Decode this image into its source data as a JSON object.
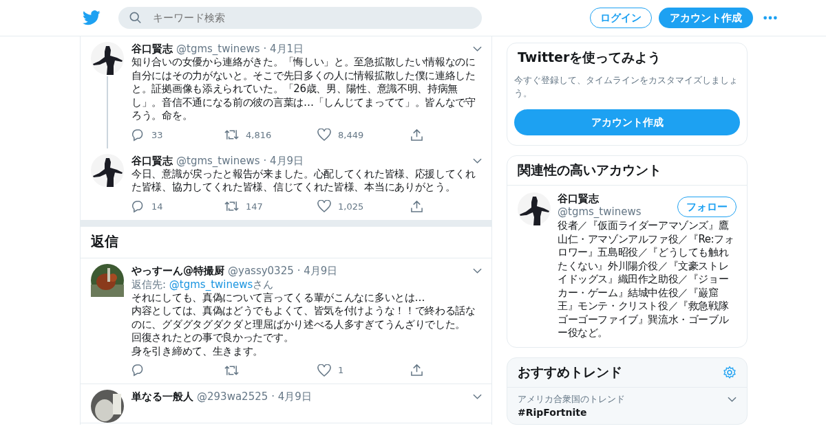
{
  "header": {
    "search_placeholder": "キーワード検索",
    "login": "ログイン",
    "signup": "アカウント作成"
  },
  "thread": [
    {
      "name": "谷口賢志",
      "handle": "@tgms_twinews",
      "date": "· 4月1日",
      "text": "知り合いの女優から連絡がきた。「悔しい」と。至急拡散したい情報なのに自分にはその力がないと。そこで先日多くの人に情報拡散した僕に連絡したと。証拠画像も添えられていた。「26歳、男、陽性、意識不明、持病無し」。音信不通になる前の彼の言葉は…「しんじてまってて」。皆んなで守ろう。命を。",
      "replies": "33",
      "retweets": "4,816",
      "likes": "8,449"
    },
    {
      "name": "谷口賢志",
      "handle": "@tgms_twinews",
      "date": "· 4月9日",
      "text": "今日、意識が戻ったと報告が来ました。心配してくれた皆様、応援してくれた皆様、協力してくれた皆様、信じてくれた皆様、本当にありがとう。",
      "replies": "14",
      "retweets": "147",
      "likes": "1,025"
    }
  ],
  "replies_heading": "返信",
  "replies": [
    {
      "name": "やっすーん@特撮厨",
      "handle": "@yassy0325",
      "date": "· 4月9日",
      "reply_label": "返信先:",
      "reply_to": "@tgms_twinews",
      "reply_suffix": "さん",
      "lines": [
        "それにしても、真偽について言ってくる輩がこんなに多いとは…",
        "内容としては、真偽はどうでもよくて、皆気を付けような！！で終わる話なのに、グダグタグダクダと理屈ばかり述べる人多すぎてうんざりでした。",
        "回復されたとの事で良かったです。",
        "身を引き締めて、生きます。"
      ],
      "likes": "1"
    },
    {
      "name": "単なる一般人",
      "handle": "@293wa2525",
      "date": "· 4月9日"
    }
  ],
  "signup_card": {
    "title": "Twitterを使ってみよう",
    "text": "今すぐ登録して、タイムラインをカスタマイズしましょう。",
    "button": "アカウント作成"
  },
  "related": {
    "title": "関連性の高いアカウント",
    "accounts": [
      {
        "name": "谷口賢志",
        "handle": "@tgms_twinews",
        "follow": "フォロー",
        "bio": "役者／『仮面ライダーアマゾンズ』鷹山仁・アマゾンアルファ役／『Re:フォロワー』五島昭役／『どうしても触れたくない』外川陽介役／『文豪ストレイドッグス』織田作之助役／『ジョーカー・ゲーム』結城中佐役／『巌窟王』モンテ・クリスト役／『救急戦隊ゴーゴーファイブ』巽流水・ゴーブルー役など。"
      }
    ]
  },
  "trends": {
    "title": "おすすめトレンド",
    "items": [
      {
        "context": "アメリカ合衆国のトレンド",
        "name": "#RipFortnite"
      }
    ]
  }
}
